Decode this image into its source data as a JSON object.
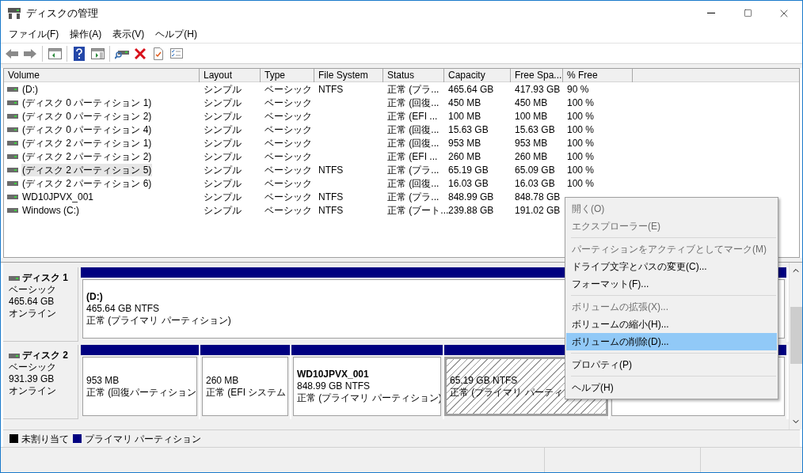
{
  "window": {
    "title": "ディスクの管理"
  },
  "menu_bar": [
    "ファイル(F)",
    "操作(A)",
    "表示(V)",
    "ヘルプ(H)"
  ],
  "volume_table": {
    "columns": [
      "Volume",
      "Layout",
      "Type",
      "File System",
      "Status",
      "Capacity",
      "Free Spa...",
      "% Free"
    ],
    "rows": [
      {
        "volume": "(D:)",
        "layout": "シンプル",
        "type": "ベーシック",
        "file_system": "NTFS",
        "status": "正常 (プラ...",
        "capacity": "465.64 GB",
        "free_space": "417.93 GB",
        "percent_free": "90 %",
        "selected": false
      },
      {
        "volume": "(ディスク 0 パーティション 1)",
        "layout": "シンプル",
        "type": "ベーシック",
        "status": "正常 (回復...",
        "capacity": "450 MB",
        "free_space": "450 MB",
        "percent_free": "100 %",
        "selected": false
      },
      {
        "volume": "(ディスク 0 パーティション 2)",
        "layout": "シンプル",
        "type": "ベーシック",
        "status": "正常 (EFI ...",
        "capacity": "100 MB",
        "free_space": "100 MB",
        "percent_free": "100 %",
        "selected": false
      },
      {
        "volume": "(ディスク 0 パーティション 4)",
        "layout": "シンプル",
        "type": "ベーシック",
        "status": "正常 (回復...",
        "capacity": "15.63 GB",
        "free_space": "15.63 GB",
        "percent_free": "100 %",
        "selected": false
      },
      {
        "volume": "(ディスク 2 パーティション 1)",
        "layout": "シンプル",
        "type": "ベーシック",
        "status": "正常 (回復...",
        "capacity": "953 MB",
        "free_space": "953 MB",
        "percent_free": "100 %",
        "selected": false
      },
      {
        "volume": "(ディスク 2 パーティション 2)",
        "layout": "シンプル",
        "type": "ベーシック",
        "status": "正常 (EFI ...",
        "capacity": "260 MB",
        "free_space": "260 MB",
        "percent_free": "100 %",
        "selected": false
      },
      {
        "volume": "(ディスク 2 パーティション 5)",
        "layout": "シンプル",
        "type": "ベーシック",
        "file_system": "NTFS",
        "status": "正常 (プラ...",
        "capacity": "65.19 GB",
        "free_space": "65.09 GB",
        "percent_free": "100 %",
        "selected": true
      },
      {
        "volume": "(ディスク 2 パーティション 6)",
        "layout": "シンプル",
        "type": "ベーシック",
        "status": "正常 (回復...",
        "capacity": "16.03 GB",
        "free_space": "16.03 GB",
        "percent_free": "100 %",
        "selected": false
      },
      {
        "volume": "WD10JPVX_001",
        "layout": "シンプル",
        "type": "ベーシック",
        "file_system": "NTFS",
        "status": "正常 (プラ...",
        "capacity": "848.99 GB",
        "free_space": "848.78 GB",
        "selected": false
      },
      {
        "volume": "Windows (C:)",
        "layout": "シンプル",
        "type": "ベーシック",
        "file_system": "NTFS",
        "status": "正常 (ブート...",
        "capacity": "239.88 GB",
        "free_space": "191.02 GB",
        "selected": false
      }
    ]
  },
  "disks": [
    {
      "name": "ディスク 1",
      "type": "ベーシック",
      "size": "465.64 GB",
      "state": "オンライン",
      "partitions": [
        {
          "name": "(D:)",
          "size": "465.64 GB NTFS",
          "status": "正常 (プライマリ パーティション)",
          "selected": false
        }
      ]
    },
    {
      "name": "ディスク 2",
      "type": "ベーシック",
      "size": "931.39 GB",
      "state": "オンライン",
      "partitions": [
        {
          "size": "953 MB",
          "status": "正常 (回復パーティション",
          "selected": false
        },
        {
          "size": "260 MB",
          "status": "正常 (EFI システム",
          "selected": false
        },
        {
          "name": "WD10JPVX_001",
          "size": "848.99 GB NTFS",
          "status": "正常 (プライマリ パーティション)",
          "selected": false
        },
        {
          "size": "65.19 GB NTFS",
          "status": "正常 (プライマリ パーティ",
          "selected": true
        },
        {
          "selected": false
        }
      ]
    }
  ],
  "legend": [
    {
      "label": "未割り当て",
      "color": "#000000"
    },
    {
      "label": "プライマリ パーティション",
      "color": "#000080"
    }
  ],
  "context_menu": [
    {
      "kind": "item",
      "label": "開く(O)",
      "disabled": true,
      "selected": false
    },
    {
      "kind": "item",
      "label": "エクスプローラー(E)",
      "disabled": true,
      "selected": false
    },
    {
      "kind": "separator"
    },
    {
      "kind": "item",
      "label": "パーティションをアクティブとしてマーク(M)",
      "disabled": true,
      "selected": false
    },
    {
      "kind": "item",
      "label": "ドライブ文字とパスの変更(C)...",
      "disabled": false,
      "selected": false
    },
    {
      "kind": "item",
      "label": "フォーマット(F)...",
      "disabled": false,
      "selected": false
    },
    {
      "kind": "separator"
    },
    {
      "kind": "item",
      "label": "ボリュームの拡張(X)...",
      "disabled": true,
      "selected": false
    },
    {
      "kind": "item",
      "label": "ボリュームの縮小(H)...",
      "disabled": false,
      "selected": false
    },
    {
      "kind": "item",
      "label": "ボリュームの削除(D)...",
      "disabled": false,
      "selected": true
    },
    {
      "kind": "separator"
    },
    {
      "kind": "item",
      "label": "プロパティ(P)",
      "disabled": false,
      "selected": false
    },
    {
      "kind": "separator"
    },
    {
      "kind": "item",
      "label": "ヘルプ(H)",
      "disabled": false,
      "selected": false
    }
  ]
}
